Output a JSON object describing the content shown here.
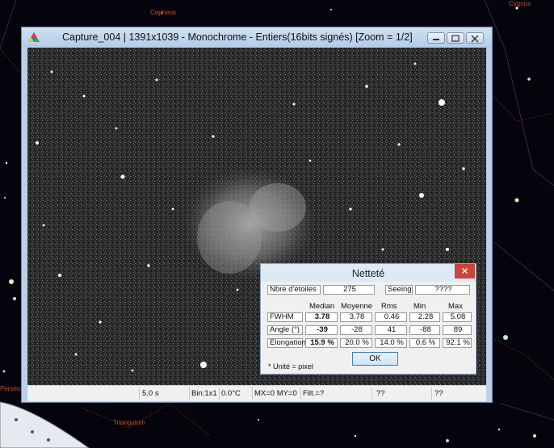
{
  "window": {
    "title": "Capture_004 | 1391x1039 - Monochrome - Entiers(16bits signés)    [Zoom = 1/2]"
  },
  "sky_labels": [
    "Cepheus",
    "Cygnus",
    "Perseus",
    "Triangulum"
  ],
  "status_bar": {
    "exposure": "5.0 s",
    "binning": "Bin:1x1",
    "temperature": "0.0°C",
    "mirror": "MX=0 MY=0",
    "filter": "Filt.=?",
    "field1": "??",
    "field2": "??"
  },
  "dialog": {
    "title": "Netteté",
    "close_glyph": "✕",
    "stars_label": "Nbre d'étoiles",
    "stars_value": "275",
    "seeing_label": "Seeing",
    "seeing_value": "????",
    "columns": [
      "Median",
      "Moyenne",
      "Rms",
      "Min",
      "Max"
    ],
    "rows": [
      {
        "label": "FWHM",
        "median": "3.78",
        "moyenne": "3.78",
        "rms": "0.46",
        "min": "2.28",
        "max": "5.08"
      },
      {
        "label": "Angle (°)",
        "median": "-39",
        "moyenne": "-28",
        "rms": "41",
        "min": "-88",
        "max": "89"
      },
      {
        "label": "Elongation",
        "median": "15.9 %",
        "moyenne": "20.0 %",
        "rms": "14.0 %",
        "min": "0.6 %",
        "max": "92.1 %"
      }
    ],
    "note": "* Unité = pixel",
    "ok_label": "OK"
  }
}
